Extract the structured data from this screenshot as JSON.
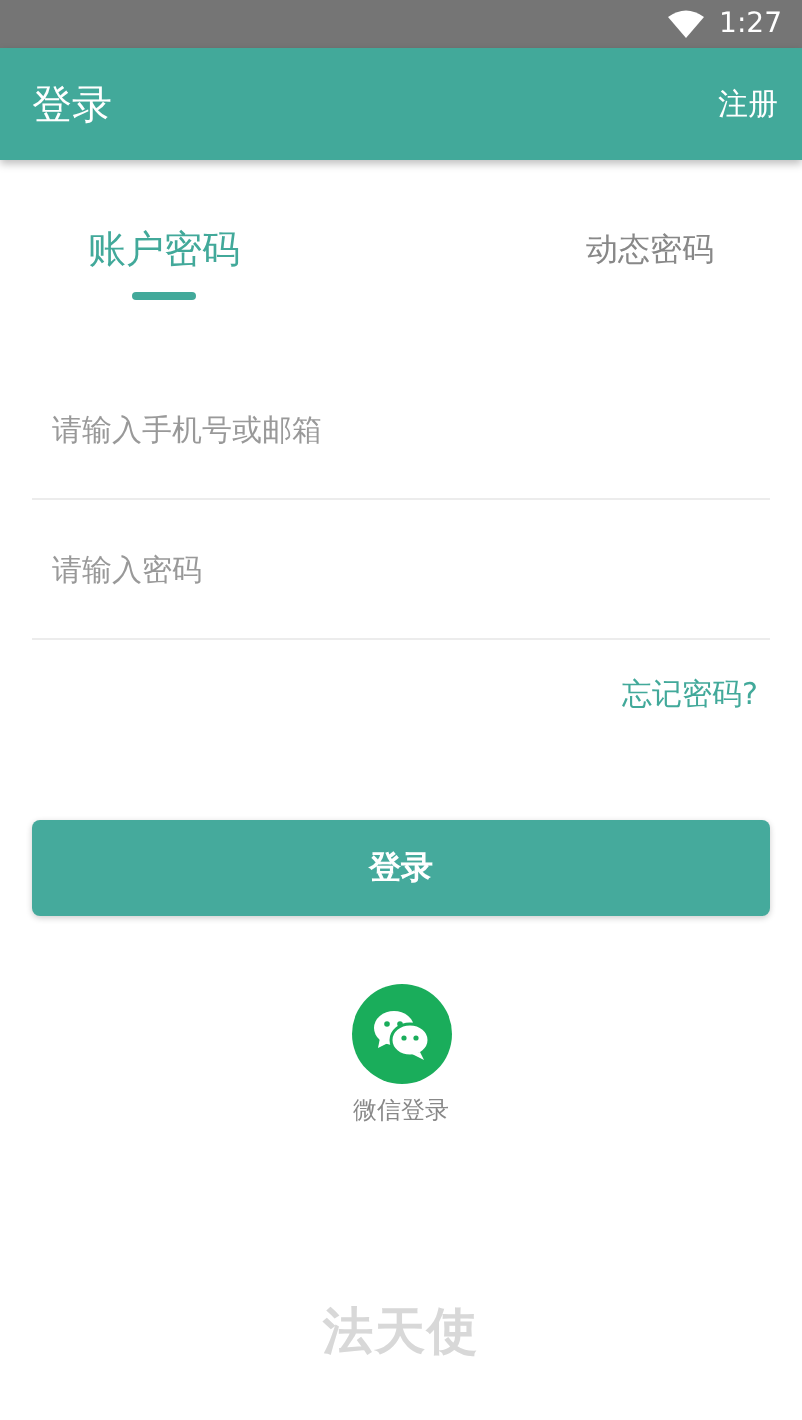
{
  "status_bar": {
    "time": "1:27"
  },
  "app_bar": {
    "title": "登录",
    "action": "注册"
  },
  "tabs": [
    {
      "label": "账户密码",
      "selected": true
    },
    {
      "label": "动态密码",
      "selected": false
    }
  ],
  "fields": [
    {
      "placeholder": "请输入手机号或邮箱"
    },
    {
      "placeholder": "请输入密码"
    }
  ],
  "forgot_link": "忘记密码?",
  "login_button": "登录",
  "wechat_login": {
    "label": "微信登录"
  },
  "footer_logo": "法天使"
}
